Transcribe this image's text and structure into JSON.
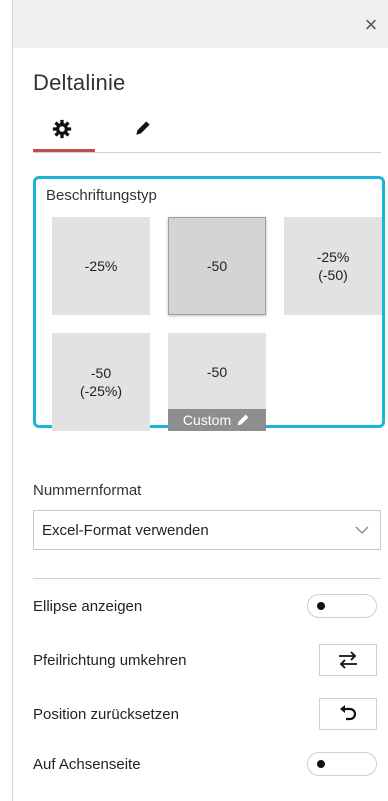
{
  "panel": {
    "close_glyph": "×",
    "title": "Deltalinie",
    "tabs": [
      {
        "icon": "gear-icon",
        "active": true
      },
      {
        "icon": "pencil-icon",
        "active": false
      }
    ],
    "accent_color": "#c0504d",
    "highlight_color": "#1cb5d8"
  },
  "label_type": {
    "heading": "Beschriftungstyp",
    "options": [
      {
        "label": "-25%",
        "selected": false
      },
      {
        "label": "-50",
        "selected": true
      },
      {
        "label": "-25%\n(-50)",
        "selected": false
      },
      {
        "label": "-50\n(-25%)",
        "selected": false
      },
      {
        "label": "-50",
        "selected": false,
        "custom_label": "Custom"
      }
    ]
  },
  "number_format": {
    "heading": "Nummernformat",
    "value": "Excel-Format verwenden"
  },
  "settings": [
    {
      "label": "Ellipse anzeigen",
      "control": "toggle",
      "on": false
    },
    {
      "label": "Pfeilrichtung umkehren",
      "control": "button",
      "icon": "swap-arrows-icon"
    },
    {
      "label": "Position zurücksetzen",
      "control": "button",
      "icon": "undo-icon"
    },
    {
      "label": "Auf Achsenseite",
      "control": "toggle",
      "on": false
    }
  ]
}
